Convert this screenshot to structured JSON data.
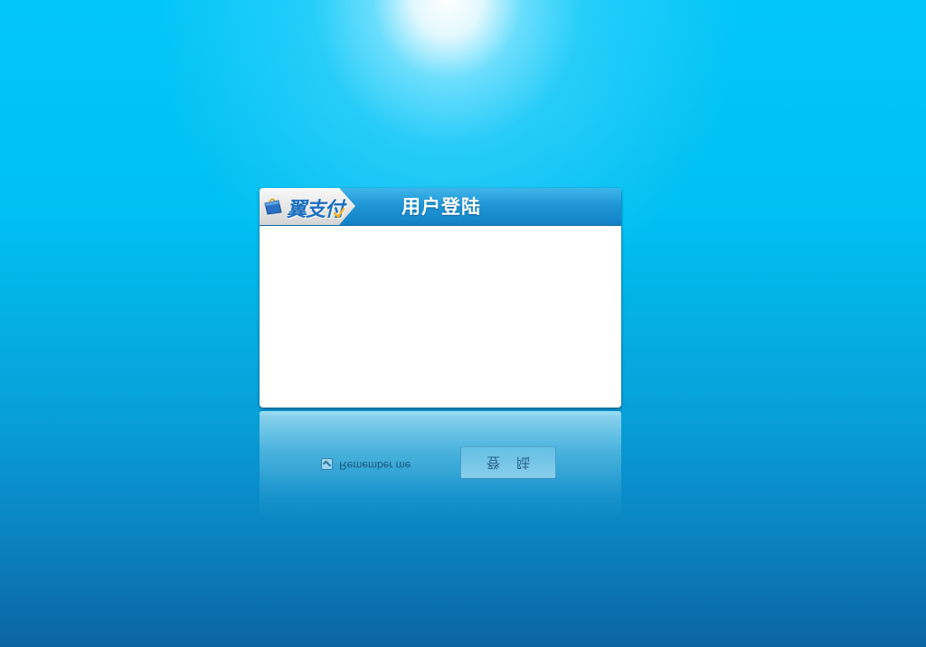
{
  "login_panel": {
    "logo_text": "翼支付",
    "title": "用户登陆"
  },
  "reflection": {
    "remember_label": "Remember me",
    "login_button_label": "登陆"
  },
  "icons": {
    "logo": "wallet-bag-icon",
    "checkbox": "checkbox-icon"
  },
  "colors": {
    "background_top": "#03c6f8",
    "background_bottom": "#0b64a2",
    "header": "#1f96d6",
    "logo_text": "#1c6fbe"
  }
}
